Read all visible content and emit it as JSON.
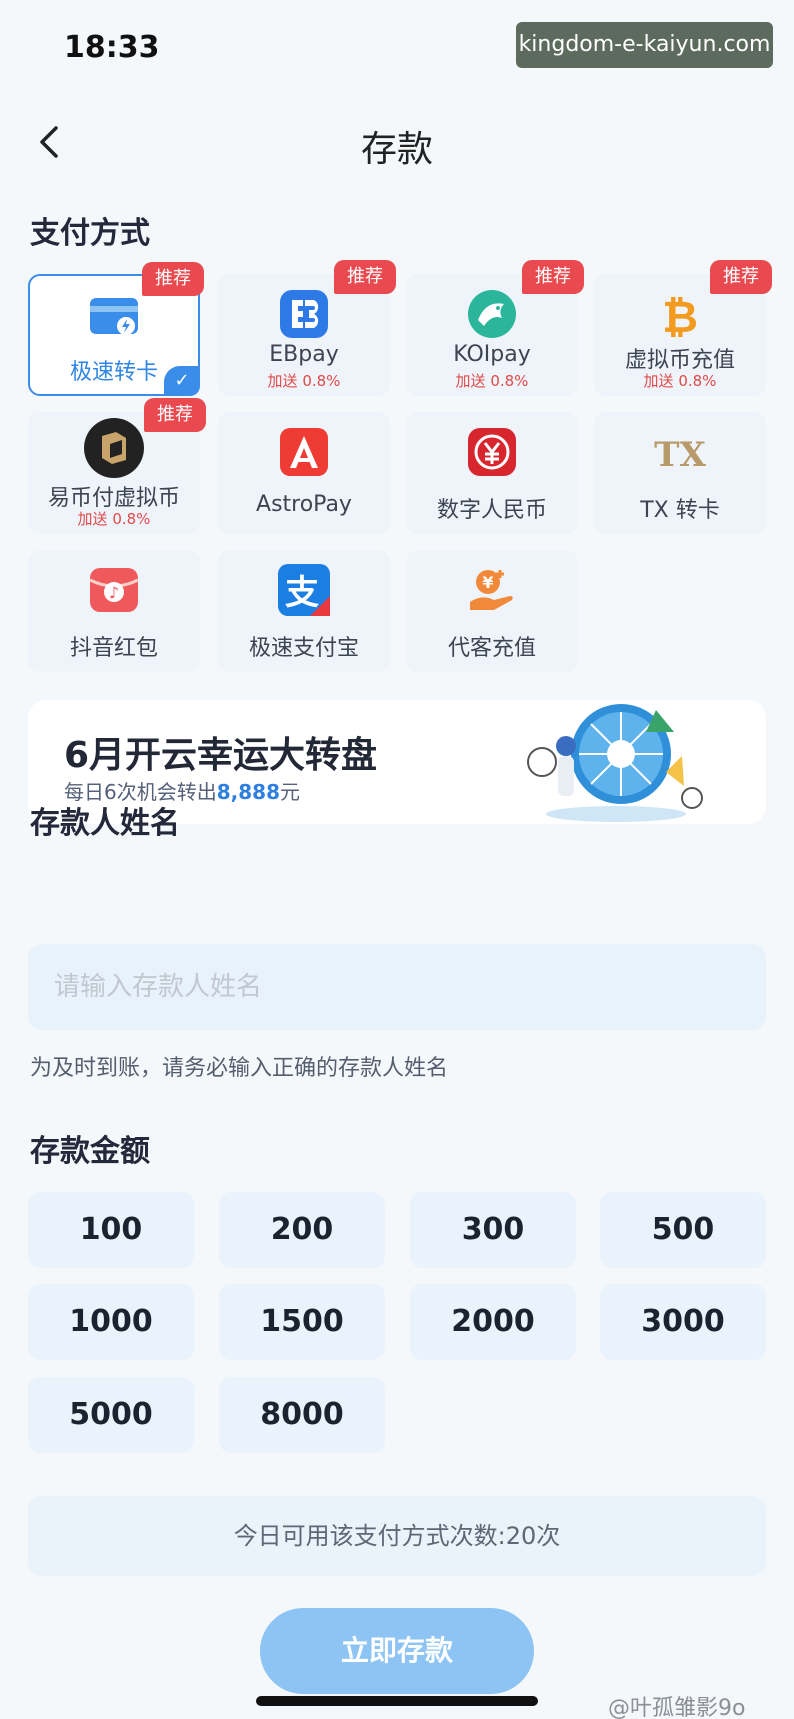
{
  "status_bar": {
    "time": "18:33"
  },
  "watermark_url": "kingdom-e-kaiyun.com",
  "nav": {
    "title": "存款"
  },
  "sections": {
    "payment_method": "支付方式",
    "depositor_name": "存款人姓名",
    "deposit_amount": "存款金额"
  },
  "payment_methods": [
    {
      "name": "极速转卡",
      "bonus": "",
      "badge": "推荐",
      "selected": true,
      "icon": "card-icon"
    },
    {
      "name": "EBpay",
      "bonus": "加送 0.8%",
      "badge": "推荐",
      "selected": false,
      "icon": "ebpay-icon"
    },
    {
      "name": "KOIpay",
      "bonus": "加送 0.8%",
      "badge": "推荐",
      "selected": false,
      "icon": "koi-fish-icon"
    },
    {
      "name": "虚拟币充值",
      "bonus": "加送 0.8%",
      "badge": "推荐",
      "selected": false,
      "icon": "bitcoin-icon"
    },
    {
      "name": "易币付虚拟币",
      "bonus": "加送 0.8%",
      "badge": "推荐",
      "selected": false,
      "icon": "yibifu-icon"
    },
    {
      "name": "AstroPay",
      "bonus": "",
      "badge": "",
      "selected": false,
      "icon": "astropay-icon"
    },
    {
      "name": "数字人民币",
      "bonus": "",
      "badge": "",
      "selected": false,
      "icon": "digital-rmb-icon"
    },
    {
      "name": "TX 转卡",
      "bonus": "",
      "badge": "",
      "selected": false,
      "icon": "tx-icon"
    },
    {
      "name": "抖音红包",
      "bonus": "",
      "badge": "",
      "selected": false,
      "icon": "douyin-envelope-icon"
    },
    {
      "name": "极速支付宝",
      "bonus": "",
      "badge": "",
      "selected": false,
      "icon": "alipay-icon"
    },
    {
      "name": "代客充值",
      "bonus": "",
      "badge": "",
      "selected": false,
      "icon": "hand-coin-icon"
    }
  ],
  "banner": {
    "title": "6月开云幸运大转盘",
    "subtitle_prefix": "每日6次机会转出",
    "subtitle_amount": "8,888",
    "subtitle_suffix": "元"
  },
  "name_input": {
    "placeholder": "请输入存款人姓名",
    "hint": "为及时到账，请务必输入正确的存款人姓名"
  },
  "amounts": [
    "100",
    "200",
    "300",
    "500",
    "1000",
    "1500",
    "2000",
    "3000",
    "5000",
    "8000"
  ],
  "quota_text": "今日可用该支付方式次数:20次",
  "submit_label": "立即存款",
  "source_mark": "@叶孤雏影9o",
  "colors": {
    "primary": "#3a8de8",
    "badge": "#e94a50",
    "submit": "#8ec4f3",
    "card_bg": "#eef4fa"
  }
}
